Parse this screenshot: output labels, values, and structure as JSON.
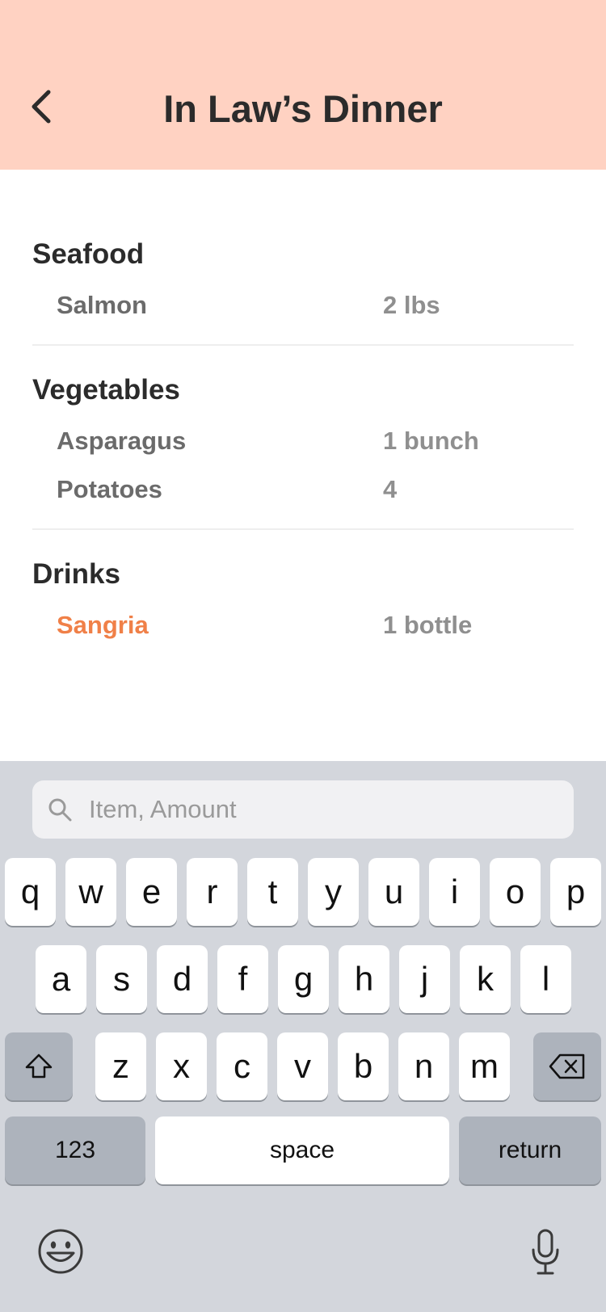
{
  "header": {
    "title": "In Law’s Dinner",
    "back_icon": "chevron-left-icon",
    "background": "#ffd2c2"
  },
  "sections": [
    {
      "title": "Seafood",
      "items": [
        {
          "name": "Salmon",
          "amount": "2 lbs"
        }
      ]
    },
    {
      "title": "Vegetables",
      "items": [
        {
          "name": "Asparagus",
          "amount": "1 bunch"
        },
        {
          "name": "Potatoes",
          "amount": "4"
        }
      ]
    },
    {
      "title": "Drinks",
      "items": [
        {
          "name": "Sangria",
          "amount": "1 bottle",
          "highlight_color": "#f08048"
        }
      ]
    }
  ],
  "search": {
    "placeholder": "Item, Amount",
    "icon": "search-icon"
  },
  "keyboard": {
    "row1": [
      "q",
      "w",
      "e",
      "r",
      "t",
      "y",
      "u",
      "i",
      "o",
      "p"
    ],
    "row2": [
      "a",
      "s",
      "d",
      "f",
      "g",
      "h",
      "j",
      "k",
      "l"
    ],
    "row3": [
      "z",
      "x",
      "c",
      "v",
      "b",
      "n",
      "m"
    ],
    "numbers_label": "123",
    "space_label": "space",
    "return_label": "return",
    "shift_icon": "shift-icon",
    "delete_icon": "backspace-icon",
    "emoji_icon": "emoji-icon",
    "mic_icon": "microphone-icon"
  }
}
